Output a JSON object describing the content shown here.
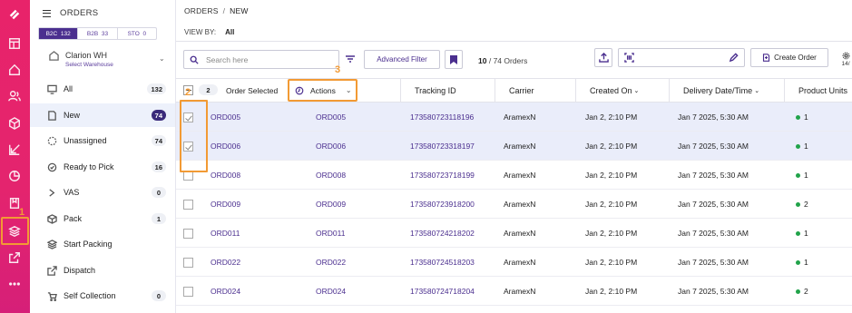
{
  "markers": [
    "1",
    "2",
    "3"
  ],
  "sidebar": {
    "title": "ORDERS",
    "segments": [
      {
        "label": "B2C",
        "count": "132"
      },
      {
        "label": "B2B",
        "count": "33"
      },
      {
        "label": "STO",
        "count": "0"
      }
    ],
    "warehouse": {
      "name": "Clarion WH",
      "action": "Select Warehouse"
    },
    "items": [
      {
        "label": "All",
        "count": "132",
        "icon": "monitor-icon"
      },
      {
        "label": "New",
        "count": "74",
        "icon": "document-icon",
        "selected": true
      },
      {
        "label": "Unassigned",
        "count": "74",
        "icon": "dashed-circle-icon"
      },
      {
        "label": "Ready to Pick",
        "count": "16",
        "icon": "circle-check-icon"
      },
      {
        "label": "VAS",
        "count": "0",
        "icon": "chevron-icon"
      },
      {
        "label": "Pack",
        "count": "1",
        "icon": "box-icon"
      },
      {
        "label": "Start Packing",
        "count": "",
        "icon": "stack-icon"
      },
      {
        "label": "Dispatch",
        "count": "",
        "icon": "export-icon"
      },
      {
        "label": "Self Collection",
        "count": "0",
        "icon": "cart-icon"
      }
    ]
  },
  "breadcrumb": {
    "root": "ORDERS",
    "sep": "/",
    "current": "NEW"
  },
  "viewby": {
    "label": "VIEW BY:",
    "value": "All"
  },
  "toolbar": {
    "search_placeholder": "Search here",
    "advanced_filter": "Advanced Filter",
    "count_current": "10",
    "count_text": "/ 74 Orders",
    "create_order": "Create Order",
    "settings_value": "14/"
  },
  "table": {
    "selected_count": "2",
    "selected_label": "Order Selected",
    "actions_label": "Actions",
    "columns": [
      "Tracking ID",
      "Carrier",
      "Created On",
      "Delivery Date/Time",
      "Product Units"
    ],
    "rows": [
      {
        "order": "ORD005",
        "ref": "ORD005",
        "tracking": "173580723118196",
        "carrier": "AramexN",
        "created": "Jan 2, 2:10 PM",
        "delivery": "Jan 7 2025, 5:30 AM",
        "units": "1",
        "checked": true
      },
      {
        "order": "ORD006",
        "ref": "ORD006",
        "tracking": "173580723318197",
        "carrier": "AramexN",
        "created": "Jan 2, 2:10 PM",
        "delivery": "Jan 7 2025, 5:30 AM",
        "units": "1",
        "checked": true
      },
      {
        "order": "ORD008",
        "ref": "ORD008",
        "tracking": "173580723718199",
        "carrier": "AramexN",
        "created": "Jan 2, 2:10 PM",
        "delivery": "Jan 7 2025, 5:30 AM",
        "units": "1",
        "checked": false
      },
      {
        "order": "ORD009",
        "ref": "ORD009",
        "tracking": "173580723918200",
        "carrier": "AramexN",
        "created": "Jan 2, 2:10 PM",
        "delivery": "Jan 7 2025, 5:30 AM",
        "units": "2",
        "checked": false
      },
      {
        "order": "ORD011",
        "ref": "ORD011",
        "tracking": "173580724218202",
        "carrier": "AramexN",
        "created": "Jan 2, 2:10 PM",
        "delivery": "Jan 7 2025, 5:30 AM",
        "units": "1",
        "checked": false
      },
      {
        "order": "ORD022",
        "ref": "ORD022",
        "tracking": "173580724518203",
        "carrier": "AramexN",
        "created": "Jan 2, 2:10 PM",
        "delivery": "Jan 7 2025, 5:30 AM",
        "units": "1",
        "checked": false
      },
      {
        "order": "ORD024",
        "ref": "ORD024",
        "tracking": "173580724718204",
        "carrier": "AramexN",
        "created": "Jan 2, 2:10 PM",
        "delivery": "Jan 7 2025, 5:30 AM",
        "units": "2",
        "checked": false
      }
    ]
  },
  "colors": {
    "brand": "#e8236a",
    "accent": "#4b2f8f",
    "highlight": "#f29a34",
    "status_green": "#21a34a"
  }
}
